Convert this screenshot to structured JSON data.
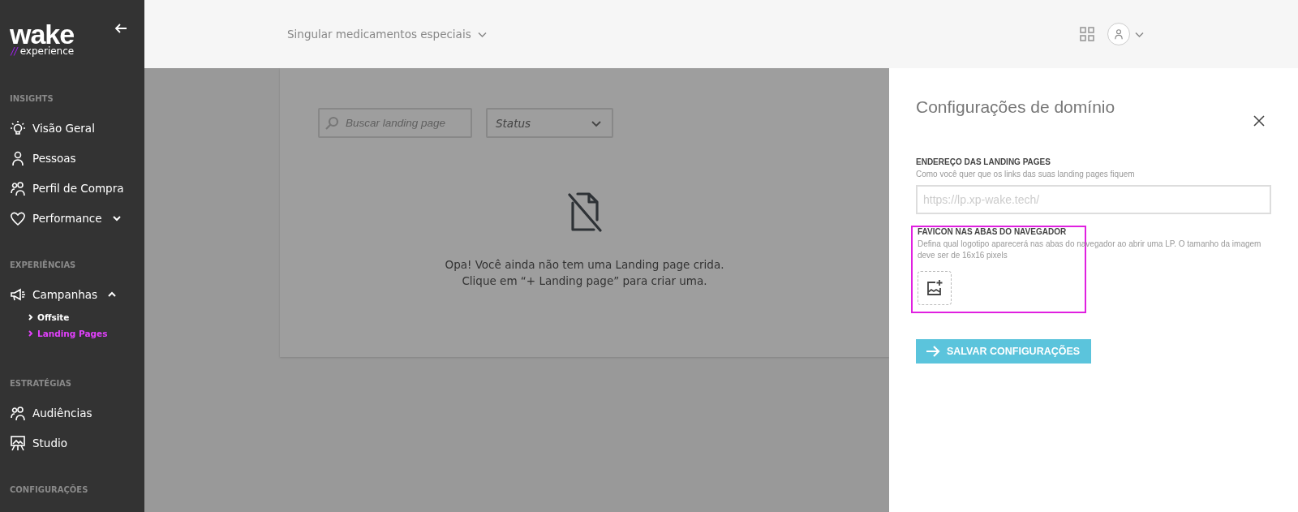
{
  "sidebar": {
    "logo": {
      "word": "wake",
      "slashes": "//",
      "tagline": "experience"
    },
    "sections": [
      {
        "title": "INSIGHTS",
        "items": [
          {
            "label": "Visão Geral"
          },
          {
            "label": "Pessoas"
          },
          {
            "label": "Perfil de Compra"
          },
          {
            "label": "Performance",
            "expanded": false
          }
        ]
      },
      {
        "title": "EXPERIÊNCIAS",
        "items": [
          {
            "label": "Campanhas",
            "expanded": true,
            "children": [
              {
                "label": "Offsite",
                "selected": false
              },
              {
                "label": "Landing Pages",
                "selected": true
              }
            ]
          }
        ]
      },
      {
        "title": "ESTRATÉGIAS",
        "items": [
          {
            "label": "Audiências"
          },
          {
            "label": "Studio"
          }
        ]
      },
      {
        "title": "CONFIGURAÇÕES"
      }
    ]
  },
  "header": {
    "store": "Singular medicamentos especiais"
  },
  "content": {
    "search": {
      "placeholder": "Buscar landing page"
    },
    "status_filter": {
      "value": "Status"
    },
    "empty_message": [
      "Opa! Você ainda não tem uma Landing page crida.",
      "Clique em “+ Landing page” para criar uma."
    ]
  },
  "drawer": {
    "title": "Configurações de domínio",
    "address": {
      "label": "ENDEREÇO DAS LANDING PAGES",
      "hint": "Como você quer que os links das suas landing pages fiquem",
      "placeholder": "https://lp.xp-wake.tech/"
    },
    "favicon": {
      "label": "FAVICON NAS ABAS DO NAVEGADOR",
      "hint": "Defina qual logotipo aparecerá nas abas do navegador ao abrir uma LP. O tamanho da imagem deve ser de 16x16 pixels",
      "highlighted": true
    },
    "save_button": "SALVAR CONFIGURAÇÕES"
  }
}
